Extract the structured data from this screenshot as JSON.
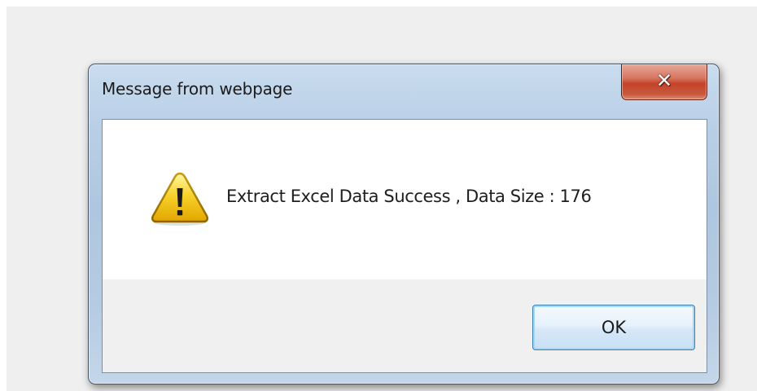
{
  "dialog": {
    "title": "Message from webpage",
    "close_icon": "close-icon",
    "message": "Extract Excel Data Success , Data Size : 176",
    "icon": "warning-icon",
    "ok_label": "OK"
  },
  "colors": {
    "close_button": "#c74a30",
    "ok_border": "#3c7fb1",
    "frame": "#b9cfe6"
  }
}
